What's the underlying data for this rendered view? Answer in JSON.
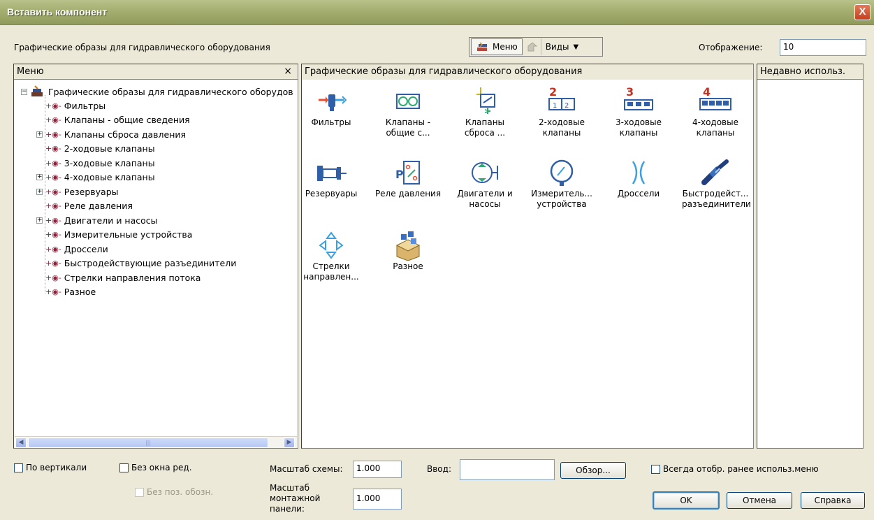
{
  "window": {
    "title": "Вставить компонент",
    "close_label": "X"
  },
  "header": {
    "description": "Графические образы для гидравлического оборудования",
    "menu_button": "Меню",
    "views_button": "Виды",
    "display_label": "Отображение:",
    "display_value": "10"
  },
  "tree": {
    "header": "Меню",
    "close": "×",
    "root": "Графические образы для гидравлического оборудов",
    "items": [
      {
        "label": "Фильтры",
        "expandable": false
      },
      {
        "label": "Клапаны - общие сведения",
        "expandable": false
      },
      {
        "label": "Клапаны сброса давления",
        "expandable": true
      },
      {
        "label": "2-ходовые клапаны",
        "expandable": false
      },
      {
        "label": "3-ходовые клапаны",
        "expandable": false
      },
      {
        "label": "4-ходовые клапаны",
        "expandable": true
      },
      {
        "label": "Резервуары",
        "expandable": true
      },
      {
        "label": "Реле давления",
        "expandable": false
      },
      {
        "label": "Двигатели и насосы",
        "expandable": true
      },
      {
        "label": "Измерительные устройства",
        "expandable": false
      },
      {
        "label": "Дроссели",
        "expandable": false
      },
      {
        "label": "Быстродействующие разъединители",
        "expandable": false
      },
      {
        "label": "Стрелки направления потока",
        "expandable": false
      },
      {
        "label": "Разное",
        "expandable": false
      }
    ]
  },
  "gallery": {
    "header": "Графические образы для гидравлического оборудования",
    "icons": [
      {
        "name": "filters",
        "line1": "Фильтры",
        "line2": ""
      },
      {
        "name": "valves-general",
        "line1": "Клапаны -",
        "line2": "общие с..."
      },
      {
        "name": "relief-valves",
        "line1": "Клапаны",
        "line2": "сброса ..."
      },
      {
        "name": "2way-valves",
        "line1": "2-ходовые",
        "line2": "клапаны"
      },
      {
        "name": "3way-valves",
        "line1": "3-ходовые",
        "line2": "клапаны"
      },
      {
        "name": "4way-valves",
        "line1": "4-ходовые",
        "line2": "клапаны"
      },
      {
        "name": "reservoirs",
        "line1": "Резервуары",
        "line2": ""
      },
      {
        "name": "pressure-switch",
        "line1": "Реле давления",
        "line2": ""
      },
      {
        "name": "motors-pumps",
        "line1": "Двигатели и",
        "line2": "насосы"
      },
      {
        "name": "measuring-devices",
        "line1": "Измеритель...",
        "line2": "устройства"
      },
      {
        "name": "throttles",
        "line1": "Дроссели",
        "line2": ""
      },
      {
        "name": "quick-disconnects",
        "line1": "Быстродейст...",
        "line2": "разъединители"
      },
      {
        "name": "flow-arrows",
        "line1": "Стрелки",
        "line2": "направлен..."
      },
      {
        "name": "misc",
        "line1": "Разное",
        "line2": ""
      }
    ],
    "numbers": {
      "two": "2",
      "three": "3",
      "four": "4"
    }
  },
  "recent": {
    "header": "Недавно использ."
  },
  "bottom": {
    "vertical": "По вертикали",
    "no_edit_window": "Без окна ред.",
    "no_pos_designation": "Без поз. обозн.",
    "scheme_scale_label": "Масштаб схемы:",
    "scheme_scale_value": "1.000",
    "panel_scale_label_1": "Масштаб",
    "panel_scale_label_2": "монтажной",
    "panel_scale_label_3": "панели:",
    "panel_scale_value": "1.000",
    "input_label": "Ввод:",
    "input_value": "",
    "browse": "Обзор...",
    "always_show": "Всегда отобр. ранее использ.меню",
    "ok": "OK",
    "cancel": "Отмена",
    "help": "Справка"
  }
}
